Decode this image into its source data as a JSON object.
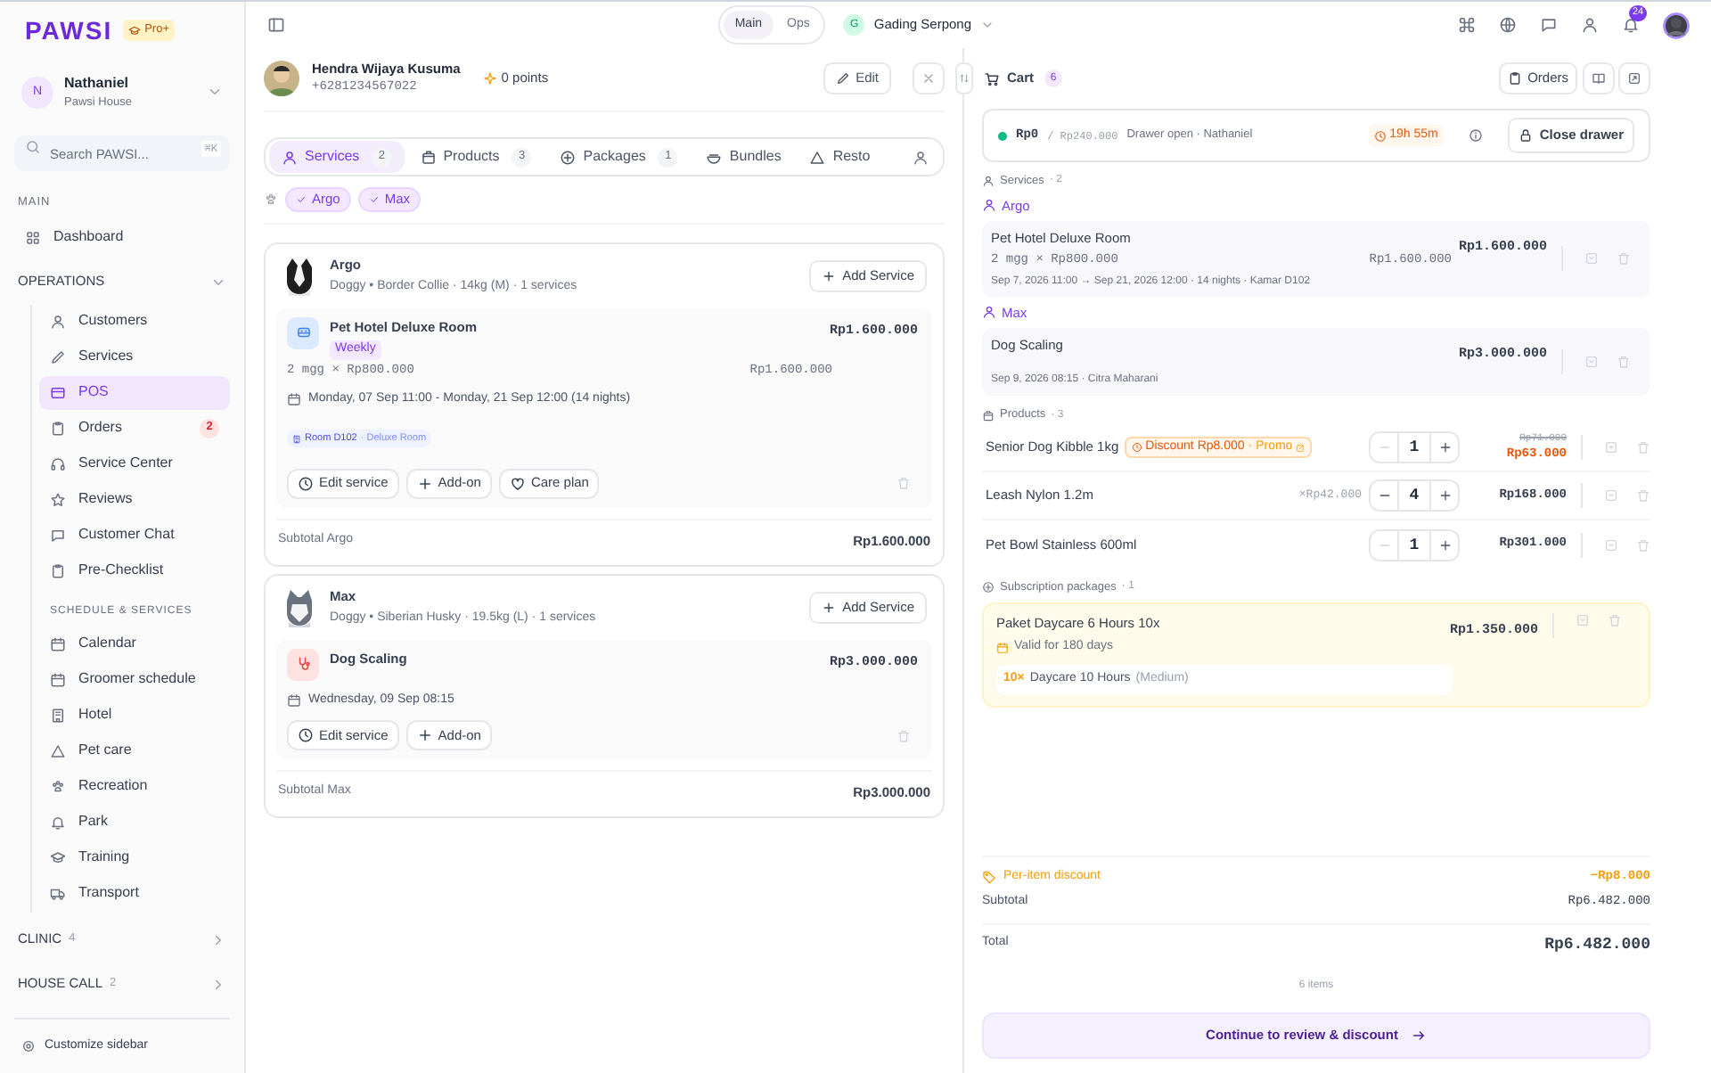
{
  "brand": {
    "logo": "PAWSI",
    "plan": "Pro+"
  },
  "account": {
    "initial": "N",
    "name": "Nathaniel",
    "org": "Pawsi House"
  },
  "search": {
    "placeholder": "Search PAWSI...",
    "shortcut": "⌘K"
  },
  "nav": {
    "main_title": "MAIN",
    "main_items": [
      {
        "label": "Dashboard",
        "selected": false
      }
    ],
    "operations": {
      "title": "OPERATIONS",
      "expanded": true,
      "items": [
        {
          "label": "Customers",
          "selected": false
        },
        {
          "label": "Services",
          "selected": false
        },
        {
          "label": "POS",
          "selected": true
        },
        {
          "label": "Orders",
          "selected": false,
          "badge": "2"
        },
        {
          "label": "Service Center",
          "selected": false
        },
        {
          "label": "Reviews",
          "selected": false
        },
        {
          "label": "Customer Chat",
          "selected": false
        },
        {
          "label": "Pre-Checklist",
          "selected": false
        }
      ],
      "subgroup_title": "SCHEDULE & SERVICES",
      "subgroup_items": [
        {
          "label": "Calendar",
          "selected": false
        },
        {
          "label": "Groomer schedule",
          "selected": false
        },
        {
          "label": "Hotel",
          "selected": false
        },
        {
          "label": "Pet care",
          "selected": false
        },
        {
          "label": "Recreation",
          "selected": false
        },
        {
          "label": "Park",
          "selected": false
        },
        {
          "label": "Training",
          "selected": false
        },
        {
          "label": "Transport",
          "selected": false
        }
      ]
    },
    "collapsed_groups": [
      {
        "title": "CLINIC",
        "count": "4",
        "expanded": false
      },
      {
        "title": "HOUSE CALL",
        "count": "2",
        "expanded": false
      }
    ]
  },
  "customize": "Customize sidebar",
  "mode_toggle": [
    {
      "label": "Main",
      "selected": true
    },
    {
      "label": "Ops",
      "selected": false
    }
  ],
  "branch": {
    "initial": "G",
    "name": "Gading Serpong"
  },
  "notifications": "24",
  "customer": {
    "name": "Hendra Wijaya Kusuma",
    "phone": "+6281234567022",
    "points": "0 points",
    "edit": "Edit"
  },
  "tabs": [
    {
      "label": "Services",
      "count": "2",
      "selected": true
    },
    {
      "label": "Products",
      "count": "3",
      "selected": false
    },
    {
      "label": "Packages",
      "count": "1",
      "selected": false
    },
    {
      "label": "Bundles",
      "selected": false
    },
    {
      "label": "Resto",
      "selected": false
    }
  ],
  "pet_filters": [
    {
      "label": "Argo",
      "selected": true
    },
    {
      "label": "Max",
      "selected": true
    }
  ],
  "pets": [
    {
      "name": "Argo",
      "details": "Doggy • Border Collie · 14kg (M) · 1 services",
      "add_button": "Add Service",
      "subtotal_label": "Subtotal Argo",
      "subtotal": "Rp1.600.000",
      "services": [
        {
          "kind": "hotel",
          "name": "Pet Hotel Deluxe Room",
          "tag": "Weekly",
          "price": "Rp1.600.000",
          "qty_line": "2 mgg × Rp800.000",
          "line_total": "Rp1.600.000",
          "schedule": "Monday, 07 Sep 11:00 - Monday, 21 Sep 12:00 (14 nights)",
          "room": "Room D102",
          "room_type": "· Deluxe Room",
          "actions": [
            "Edit service",
            "Add-on",
            "Care plan"
          ]
        }
      ]
    },
    {
      "name": "Max",
      "details": "Doggy • Siberian Husky · 19.5kg (L) · 1 services",
      "add_button": "Add Service",
      "subtotal_label": "Subtotal Max",
      "subtotal": "Rp3.000.000",
      "services": [
        {
          "kind": "grooming",
          "name": "Dog Scaling",
          "price": "Rp3.000.000",
          "schedule": "Wednesday, 09 Sep 08:15",
          "actions": [
            "Edit service",
            "Add-on"
          ]
        }
      ]
    }
  ],
  "cart": {
    "title": "Cart",
    "count": "6",
    "orders_button": "Orders",
    "drawer": {
      "open": true,
      "amount": "Rp0",
      "target": "/ Rp240.000",
      "status": "Drawer open · Nathaniel",
      "timer": "19h 55m",
      "button": "Close drawer"
    },
    "services": {
      "title": "Services",
      "count": "· 2",
      "groups": [
        {
          "pet": "Argo",
          "items": [
            {
              "name": "Pet Hotel Deluxe Room",
              "qty_line": "2 mgg × Rp800.000",
              "line_total": "Rp1.600.000",
              "price": "Rp1.600.000",
              "meta": "Sep 7, 2026 11:00 → Sep 21, 2026 12:00 · 14 nights · Kamar D102"
            }
          ]
        },
        {
          "pet": "Max",
          "items": [
            {
              "name": "Dog Scaling",
              "price": "Rp3.000.000",
              "meta": "Sep 9, 2026 08:15 · Citra Maharani"
            }
          ]
        }
      ]
    },
    "products": {
      "title": "Products",
      "count": "· 3",
      "items": [
        {
          "name": "Senior Dog Kibble 1kg",
          "discount": "Discount Rp8.000",
          "promo": "· Promo",
          "qty": "1",
          "old_price": "Rp71.000",
          "price": "Rp63.000"
        },
        {
          "name": "Leash Nylon 1.2m",
          "unit": "×Rp42.000",
          "qty": "4",
          "price": "Rp168.000"
        },
        {
          "name": "Pet Bowl Stainless 600ml",
          "qty": "1",
          "price": "Rp301.000"
        }
      ]
    },
    "packages": {
      "title": "Subscription packages",
      "count": "· 1",
      "items": [
        {
          "name": "Paket Daycare 6 Hours 10x",
          "validity": "Valid for 180 days",
          "price": "Rp1.350.000",
          "contents": [
            {
              "qty": "10×",
              "name": "Daycare 10 Hours",
              "size": "(Medium)"
            }
          ]
        }
      ]
    },
    "summary": {
      "discount_label": "Per-item discount",
      "discount": "−Rp8.000",
      "subtotal_label": "Subtotal",
      "subtotal": "Rp6.482.000",
      "total_label": "Total",
      "total": "Rp6.482.000",
      "items_count": "6 items"
    },
    "cta": "Continue to review & discount"
  }
}
